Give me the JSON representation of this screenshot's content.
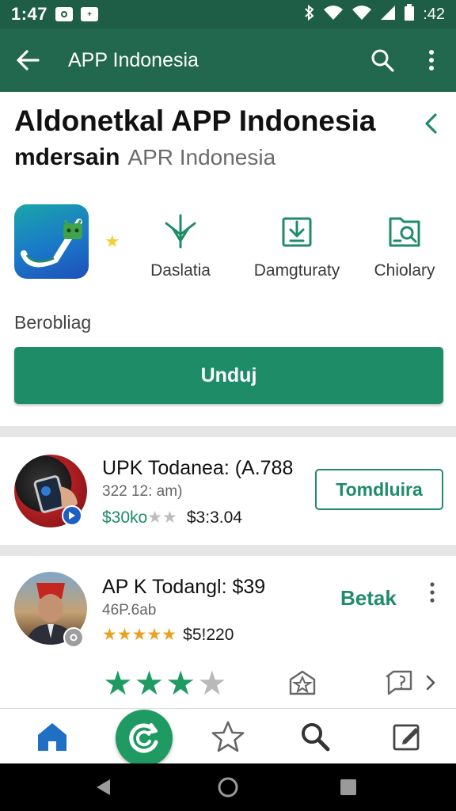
{
  "status_bar": {
    "time": "1:47",
    "notif_badge": "+",
    "clock_right": ":42",
    "icons": [
      "camera-notif-icon",
      "plus-notif-icon",
      "bluetooth-icon",
      "wifi-icon",
      "signal-icon",
      "battery-icon"
    ]
  },
  "app_bar": {
    "title": "APP Indonesia",
    "icons": [
      "back-arrow-icon",
      "search-icon",
      "more-vert-icon"
    ]
  },
  "header": {
    "headline": "Aldonetkal APP Indonesia",
    "sub_bold": "mdersain",
    "sub_light": "APR Indonesia"
  },
  "features": [
    {
      "label": "Daslatia",
      "icon": "antenna-icon"
    },
    {
      "label": "Damgturaty",
      "icon": "download-box-icon"
    },
    {
      "label": "Chiolary",
      "icon": "folder-search-icon"
    }
  ],
  "caption": "Berobliag",
  "install_button": "Unduj",
  "items": [
    {
      "title": "UPK Todanea: (A.788",
      "subtitle": "322 12: am)",
      "price_green": "$30ko",
      "price": "$3:3.04",
      "action": "Tomdluira"
    },
    {
      "title": "AP K Todangl: $39",
      "subtitle": "46P.6ab",
      "price": "$5!220",
      "action": "Betak"
    }
  ],
  "rating_row": {
    "filled_stars": 3,
    "total_stars": 4
  },
  "bottom_nav": {
    "icons": [
      "home-icon",
      "refresh-fab-icon",
      "star-outline-icon",
      "search-icon",
      "edit-icon"
    ]
  },
  "system_nav": {
    "icons": [
      "back-triangle-icon",
      "home-circle-icon",
      "recents-square-icon"
    ]
  },
  "colors": {
    "status_bar": "#1e5e46",
    "app_bar": "#22684f",
    "accent": "#1e8c66",
    "star_gold": "#e8a21e"
  }
}
